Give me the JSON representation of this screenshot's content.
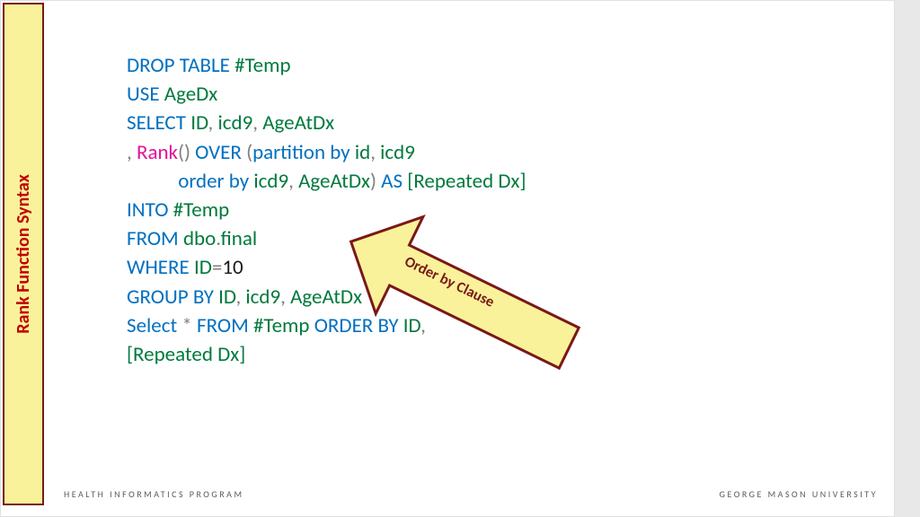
{
  "sidebar": {
    "title": "Rank Function Syntax"
  },
  "code": {
    "l1_a": "DROP TABLE ",
    "l1_b": "#Temp",
    "l2_a": "USE ",
    "l2_b": "AgeDx",
    "l3_a": "SELECT ",
    "l3_b": "ID",
    "l3_c": ", ",
    "l3_d": "icd9",
    "l3_e": ", ",
    "l3_f": "AgeAtDx",
    "l4_a": ", ",
    "l4_b": "Rank",
    "l4_c": "()",
    "l4_d": " OVER ",
    "l4_e": "(",
    "l4_f": "partition by ",
    "l4_g": "id",
    "l4_h": ", ",
    "l4_i": "icd9",
    "l5_a": "           order by ",
    "l5_b": "icd9",
    "l5_c": ", ",
    "l5_d": "AgeAtDx",
    "l5_e": ")",
    "l5_f": " AS ",
    "l5_g": "[Repeated Dx]",
    "l6_a": "INTO ",
    "l6_b": "#Temp",
    "l7_a": "FROM ",
    "l7_b": "dbo",
    "l7_c": ".",
    "l7_d": "final",
    "l8_a": "WHERE ",
    "l8_b": "ID",
    "l8_c": "=",
    "l8_d": "10",
    "l9_a": "GROUP BY ",
    "l9_b": "ID",
    "l9_c": ", ",
    "l9_d": "icd9",
    "l9_e": ", ",
    "l9_f": "AgeAtDx",
    "l10_a": "Select ",
    "l10_b": "*",
    "l10_c": " FROM ",
    "l10_d": "#Temp",
    "l10_e": " ORDER BY ",
    "l10_f": "ID",
    "l10_g": ", ",
    "l11_a": "[Repeated Dx]"
  },
  "arrow": {
    "label": "Order by Clause"
  },
  "footer": {
    "left": "HEALTH INFORMATICS PROGRAM",
    "right": "GEORGE MASON UNIVERSITY"
  }
}
